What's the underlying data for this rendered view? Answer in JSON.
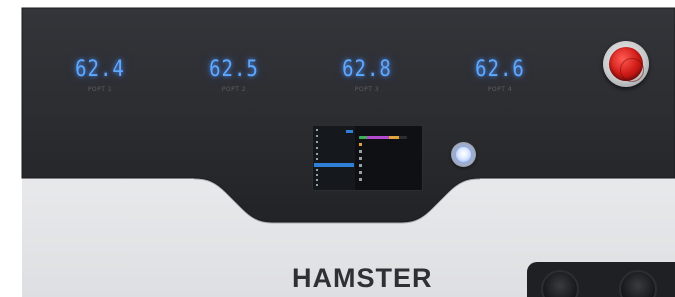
{
  "readouts": [
    {
      "value": "62.4",
      "label": "POPT 1"
    },
    {
      "value": "62.5",
      "label": "POPT 2"
    },
    {
      "value": "62.8",
      "label": "POPT 3"
    },
    {
      "value": "62.6",
      "label": "POPT 4"
    }
  ],
  "brand": "HAMSTER",
  "colors": {
    "panel": "#2b2c2f",
    "display": "#5fa8ff",
    "estop": "#d11c18",
    "screen_accent": "#2f7fd6"
  },
  "icons": {
    "estop": "emergency-stop-icon",
    "light_button": "illuminated-button-icon"
  }
}
